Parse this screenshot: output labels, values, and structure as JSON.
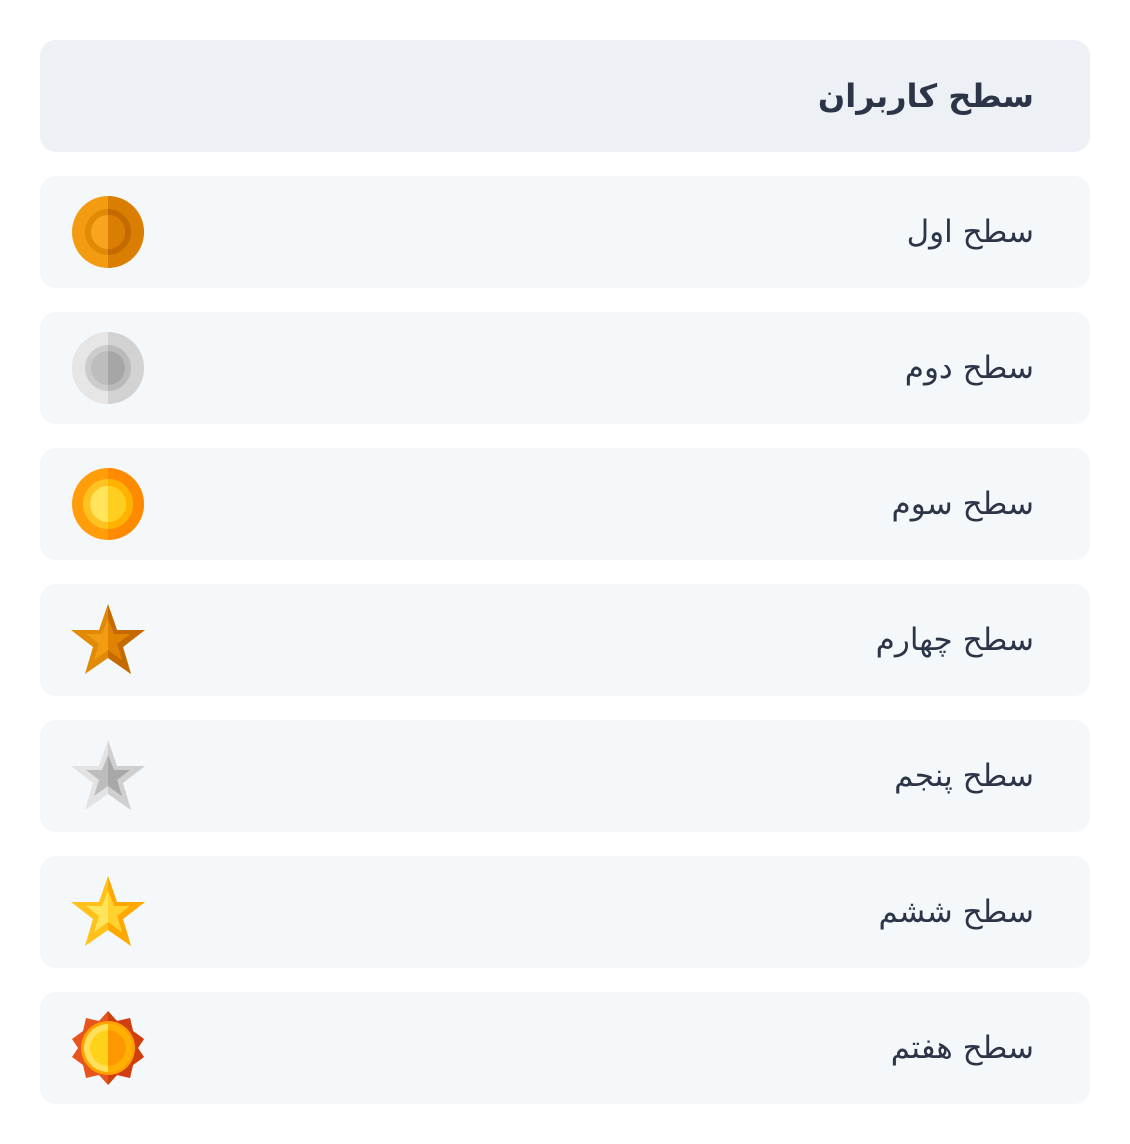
{
  "header": {
    "title": "سطح کاربران"
  },
  "levels": [
    {
      "label": "سطح اول",
      "icon": "bronze-medal-icon"
    },
    {
      "label": "سطح دوم",
      "icon": "silver-medal-icon"
    },
    {
      "label": "سطح سوم",
      "icon": "gold-medal-icon"
    },
    {
      "label": "سطح چهارم",
      "icon": "bronze-star-icon"
    },
    {
      "label": "سطح پنجم",
      "icon": "silver-star-icon"
    },
    {
      "label": "سطح ششم",
      "icon": "gold-star-icon"
    },
    {
      "label": "سطح هفتم",
      "icon": "sun-badge-icon"
    }
  ],
  "colors": {
    "header_bg": "#edf1f5",
    "row_bg": "#f4f8fb",
    "text": "#2c3448",
    "bronze": "#e5860a",
    "silver": "#d9d9d9",
    "gold": "#ffc107"
  }
}
